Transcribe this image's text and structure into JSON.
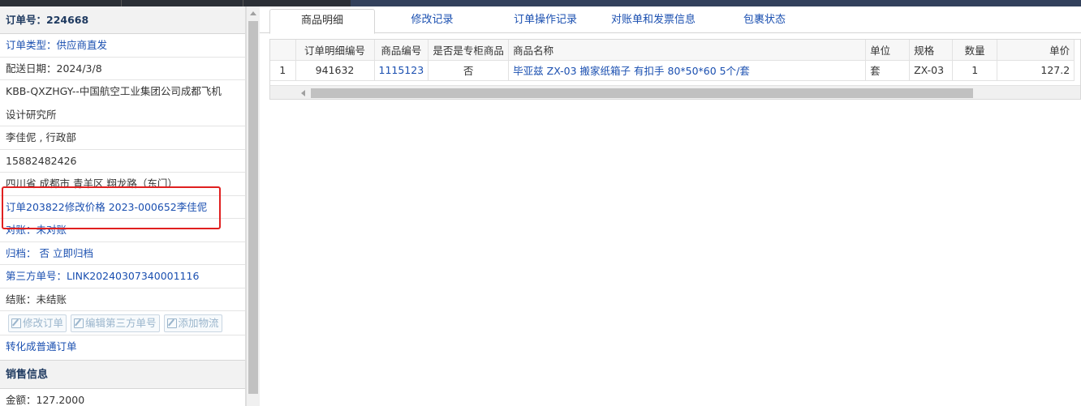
{
  "order": {
    "number_label": "订单号：",
    "number": "224668",
    "type_label": "订单类型：",
    "type": "供应商直发",
    "delivery_label": "配送日期：",
    "delivery_date": "2024/3/8",
    "customer_line1": "KBB-QXZHGY--中国航空工业集团公司成都飞机",
    "customer_line2": "设计研究所",
    "contact": "李佳伲 , 行政部",
    "phone": "15882482426",
    "address": "四川省 成都市 青羊区 翔龙路（东门）",
    "remark": "订单203822修改价格 2023-000652李佳伲",
    "reconcile_label": "对账：",
    "reconcile": "未对账",
    "archive_label": "归档：",
    "archive": "否",
    "archive_action": "立即归档",
    "third_party_label": "第三方单号：",
    "third_party": "LINK20240307340001116",
    "settle_label": "结账：",
    "settle": "未结账",
    "actions": {
      "edit_order": "修改订单",
      "edit_third_party": "编辑第三方单号",
      "add_logistics": "添加物流"
    },
    "convert_link": "转化成普通订单"
  },
  "sales": {
    "section_title": "销售信息",
    "amount_label": "金额：",
    "amount": "127.2000"
  },
  "tabs": [
    {
      "label": "商品明细"
    },
    {
      "label": "修改记录"
    },
    {
      "label": "订单操作记录"
    },
    {
      "label": "对账单和发票信息"
    },
    {
      "label": "包裹状态"
    }
  ],
  "table": {
    "headers": [
      "",
      "订单明细编号",
      "商品编号",
      "是否是专柜商品",
      "商品名称",
      "单位",
      "规格",
      "数量",
      "单价"
    ],
    "rows": [
      [
        "1",
        "941632",
        "1115123",
        "否",
        "毕亚兹 ZX-03 搬家纸箱子 有扣手 80*50*60 5个/套",
        "套",
        "ZX-03",
        "1",
        "127.2"
      ]
    ]
  },
  "colors": {
    "link": "#1a4fb0",
    "highlight_box": "#e02020"
  }
}
